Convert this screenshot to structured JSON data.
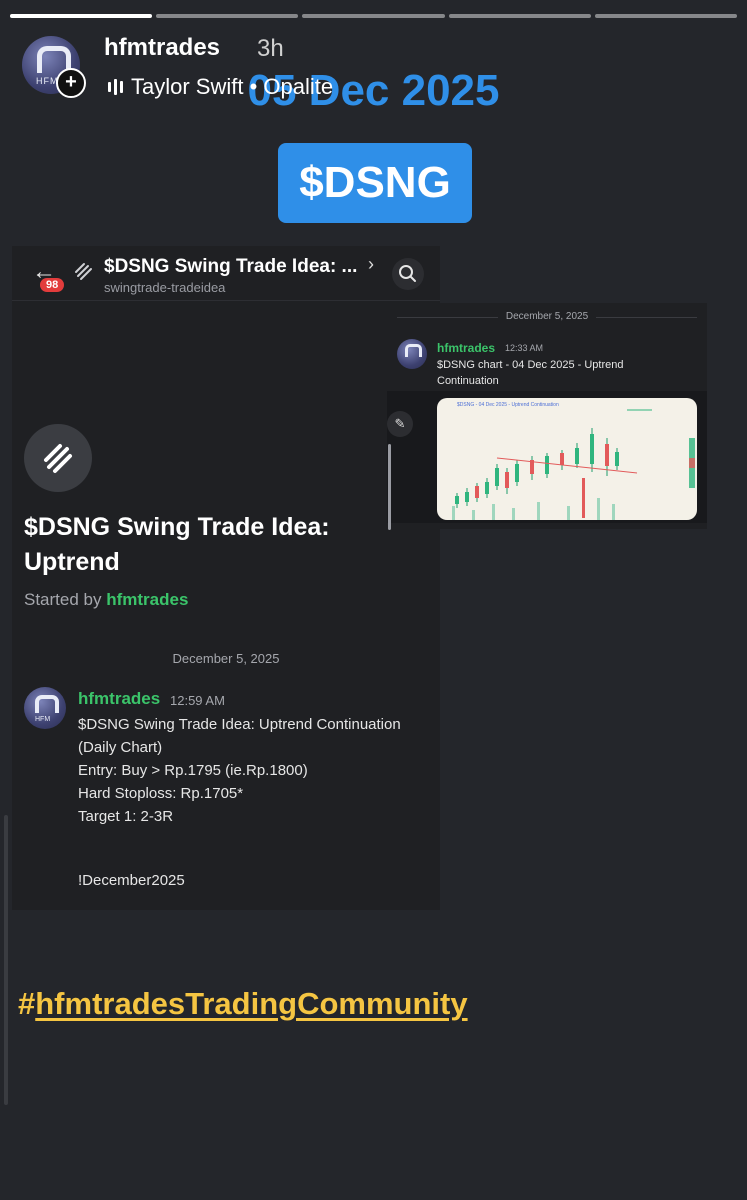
{
  "story": {
    "progress_segments": 5,
    "active_segment": 0,
    "username": "hfmtrades",
    "time_ago": "3h",
    "music": "Taylor Swift • Opalite",
    "date_overlay": "05 Dec 2025",
    "ticker_label": "$DSNG",
    "hashtag_prefix": "#",
    "hashtag_text": "hfmtradesTradingCommunity",
    "colors": {
      "accent_blue": "#2f8fe8",
      "hashtag_yellow": "#f5c542",
      "discord_green": "#3bc46a"
    }
  },
  "avatar": {
    "text": "HFM"
  },
  "discord_main": {
    "back_badge": "98",
    "topbar_title": "$DSNG Swing Trade Idea: ...",
    "topbar_subtitle": "swingtrade-tradeidea",
    "thread_title": "$DSNG Swing Trade Idea: Uptrend",
    "started_by_label": "Started by",
    "started_by_user": "hfmtrades",
    "date_divider": "December 5, 2025",
    "message": {
      "user": "hfmtrades",
      "time": "12:59 AM",
      "lines": [
        "$DSNG Swing Trade Idea: Uptrend Continuation",
        "(Daily Chart)",
        "Entry: Buy > Rp.1795 (ie.Rp.1800)",
        "Hard Stoploss: Rp.1705*",
        "Target 1: 2-3R"
      ],
      "tag": "!December2025"
    }
  },
  "discord_second": {
    "date_divider": "December 5, 2025",
    "user": "hfmtrades",
    "time": "12:33 AM",
    "text": "$DSNG chart - 04 Dec 2025 - Uptrend Continuation",
    "chart_image_title": "$DSNG - 04 Dec 2025 - Uptrend Continuation"
  }
}
